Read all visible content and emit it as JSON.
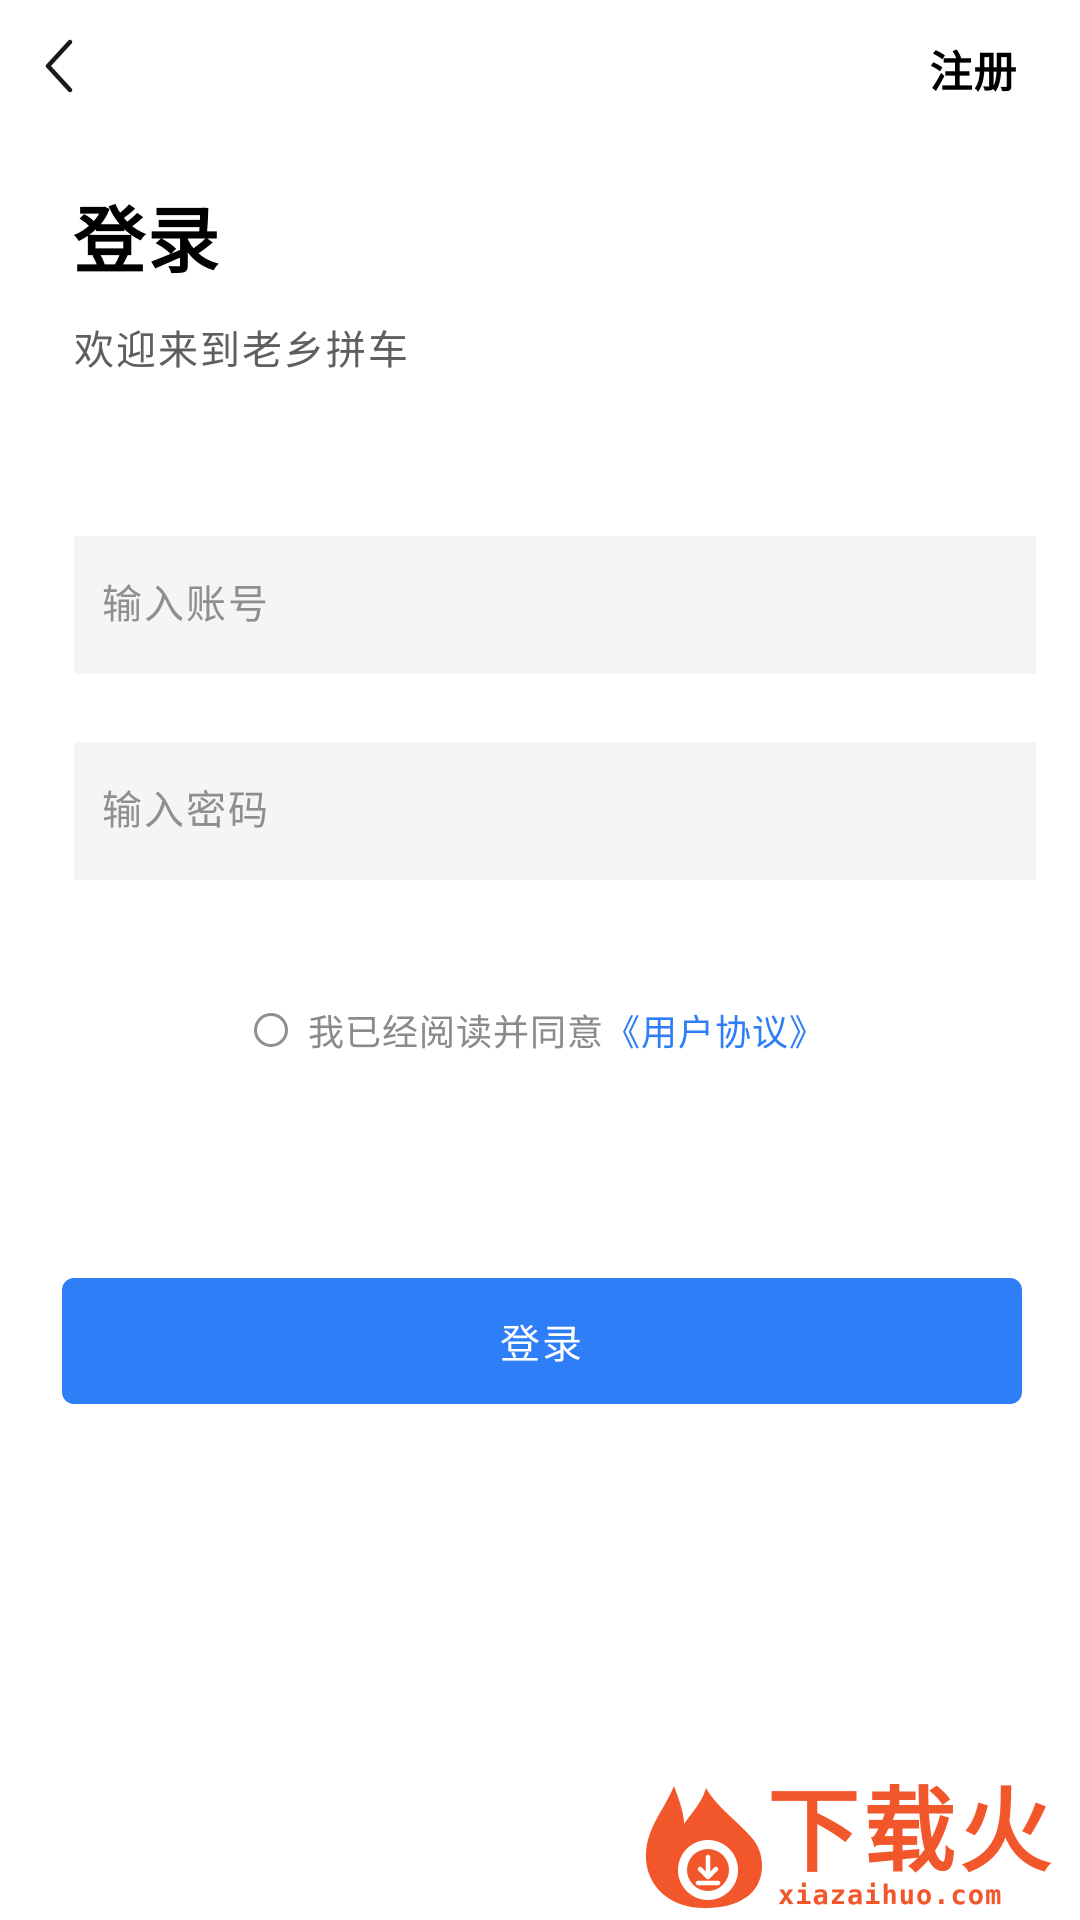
{
  "header": {
    "back_icon": "chevron-left-icon",
    "register_label": "注册"
  },
  "title": "登录",
  "subtitle": "欢迎来到老乡拼车",
  "form": {
    "account": {
      "value": "",
      "placeholder": "输入账号"
    },
    "password": {
      "value": "",
      "placeholder": "输入密码"
    }
  },
  "agreement": {
    "checked": false,
    "text": "我已经阅读并同意",
    "link_label": "《用户协议》"
  },
  "login_button_label": "登录",
  "watermark": {
    "title": "下载火",
    "url": "xiazaihuo.com"
  },
  "colors": {
    "primary": "#2e7ef8",
    "input_background": "#f5f5f5",
    "placeholder": "#8f8f8f",
    "watermark": "#f2562b"
  }
}
